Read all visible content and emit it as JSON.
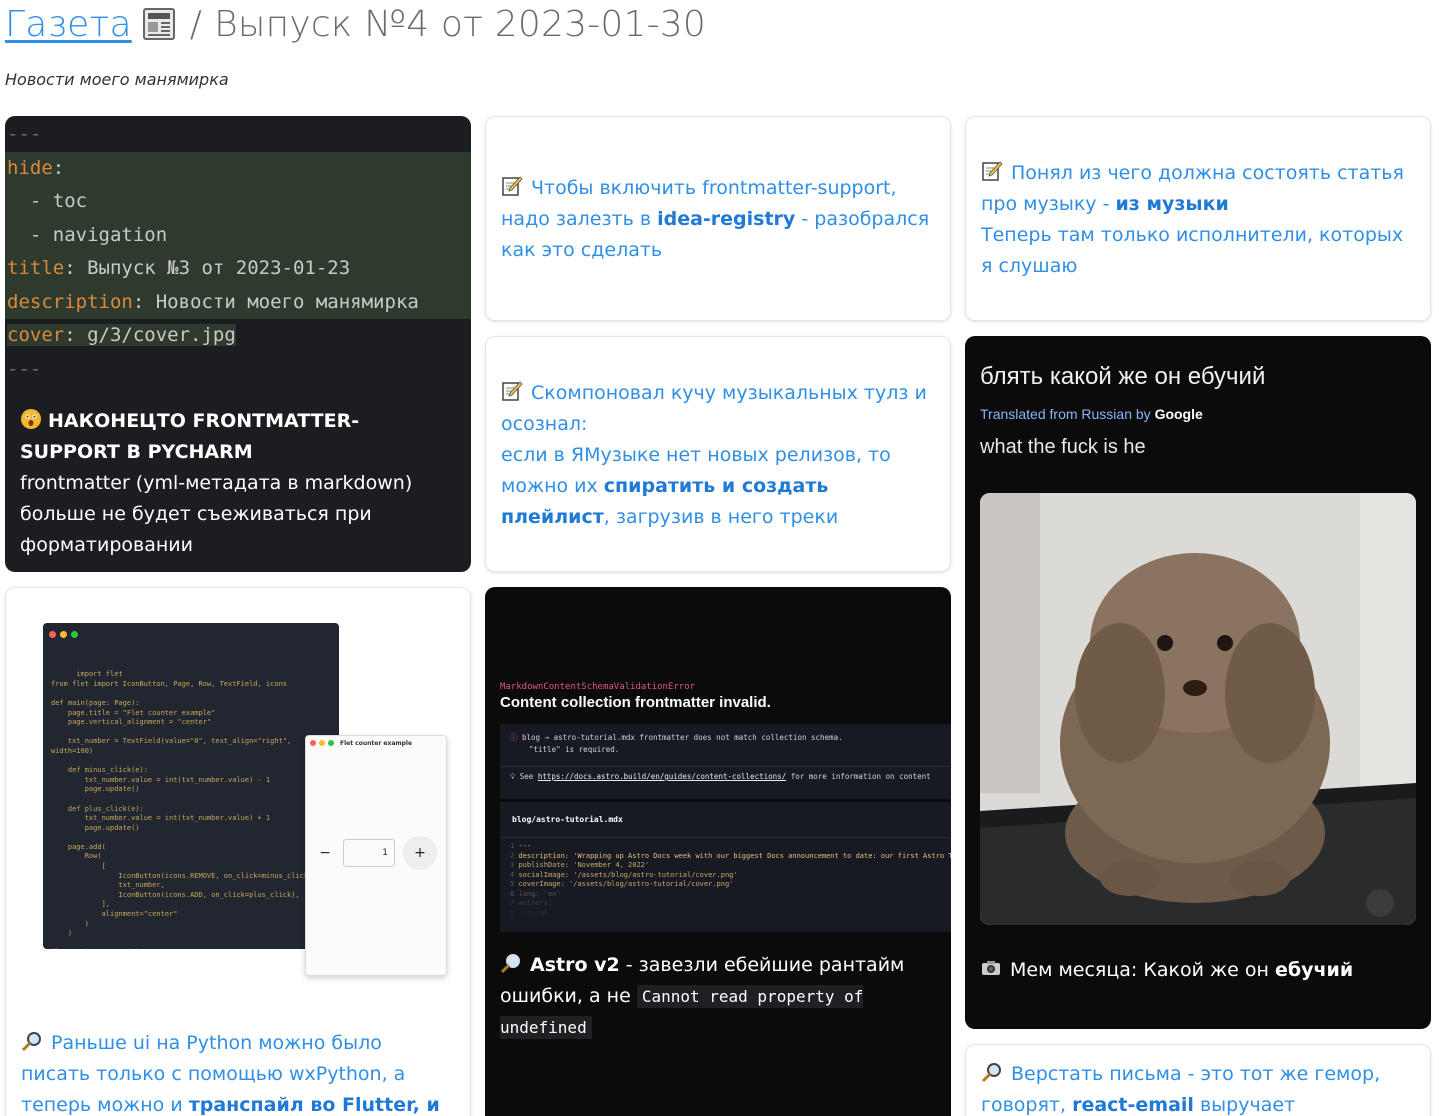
{
  "header": {
    "link_label": "Газета",
    "separator": "/",
    "issue_title": "Выпуск №4 от 2023-01-30",
    "subtitle": "Новости моего манямирка"
  },
  "cards": {
    "frontmatter": {
      "code_lines": [
        "---",
        "hide:",
        "  - toc",
        "  - navigation",
        "title: Выпуск №3 от 2023-01-23",
        "description: Новости моего манямирка",
        "cover: g/3/cover.jpg",
        "---"
      ],
      "heading": "НАКОНЕЦТО FRONTMATTER-SUPPORT В PYCHARM",
      "body": "frontmatter (yml-метадата в markdown) больше не будет съеживаться при форматировании",
      "emoji": "astonished-face-icon"
    },
    "idea_registry": {
      "text_before": "Чтобы включить frontmatter-support, надо залезть в ",
      "bold": "idea-registry",
      "text_after": " - разобрался как это сделать",
      "emoji": "memo-icon"
    },
    "music_article": {
      "text_before": "Понял из чего должна состоять статья про музыку - ",
      "bold": "из музыки",
      "line2": "Теперь там только исполнители, которых я слушаю",
      "emoji": "memo-icon"
    },
    "music_tools": {
      "line1": "Скомпоновал кучу музыкальных тулз и осознал:",
      "text_before": "если в ЯМузыке нет новых релизов, то можно их ",
      "bold": "спиратить и создать плейлист",
      "text_after": ", загрузив в него треки",
      "emoji": "memo-icon"
    },
    "meme": {
      "ru_text": "блять какой же он ебучий",
      "translated_prefix": "Translated from Russian by",
      "translated_brand": "Google",
      "en_text": "what the fuck is he",
      "caption_before": "Мем месяца: Какой же он ",
      "caption_bold": "ебучий",
      "emoji": "camera-icon"
    },
    "flet": {
      "code": "import flet\nfrom flet import IconButton, Page, Row, TextField, icons\n\ndef main(page: Page):\n    page.title = \"Flet counter example\"\n    page.vertical_alignment = \"center\"\n\n    txt_number = TextField(value=\"0\", text_align=\"right\",\nwidth=100)\n\n    def minus_click(e):\n        txt_number.value = int(txt_number.value) - 1\n        page.update()\n\n    def plus_click(e):\n        txt_number.value = int(txt_number.value) + 1\n        page.update()\n\n    page.add(\n        Row(\n            [\n                IconButton(icons.REMOVE, on_click=minus_click),\n                txt_number,\n                IconButton(icons.ADD, on_click=plus_click),\n            ],\n            alignment=\"center\"\n        )\n    )\n\nflet.app(target=main)",
      "app_title": "Flet counter example",
      "counter_value": "1",
      "minus": "−",
      "plus": "+",
      "text_before": "Раньше ui на Python можно было писать только с помощью wxPython, а теперь можно и ",
      "bold": "транспайл во Flutter, и в React",
      "emoji": "magnifier-icon"
    },
    "astro": {
      "error_type": "MarkdownContentSchemaValidationError",
      "error_message": "Content collection frontmatter invalid.",
      "detail_line1": "blog → astro-tutorial.mdx frontmatter does not match collection schema.",
      "detail_line2": "\"title\" is required.",
      "hint_prefix": "See ",
      "hint_link": "https://docs.astro.build/en/guides/content-collections/",
      "hint_suffix": " for more information on content",
      "file_name": "blog/astro-tutorial.mdx",
      "file_lines": [
        "---",
        "description: 'Wrapping up Astro Docs week with our biggest Docs announcement to date: our first Astro Tu",
        "publishDate: 'November 4, 2022'",
        "socialImage: '/assets/blog/astro-tutorial/cover.png'",
        "coverImage: '/assets/blog/astro-tutorial/cover.png'",
        "lang: 'en'",
        "authors:",
        "  - sarah"
      ],
      "bold": "Astro v2",
      "text_mid": " - завезли ебейшие рантайм ошибки, а не ",
      "code": "Cannot read property of undefined",
      "emoji": "magnifier-icon"
    },
    "email": {
      "text_before": "Верстать письма - это тот же гемор, говорят, ",
      "bold": "react-email",
      "text_after": " выручает",
      "emoji": "magnifier-icon"
    }
  },
  "colors": {
    "link": "#2f8fe6",
    "dark_card": "#1c1d21",
    "black_card": "#0b0b0c",
    "yaml_key": "#d9893c"
  }
}
